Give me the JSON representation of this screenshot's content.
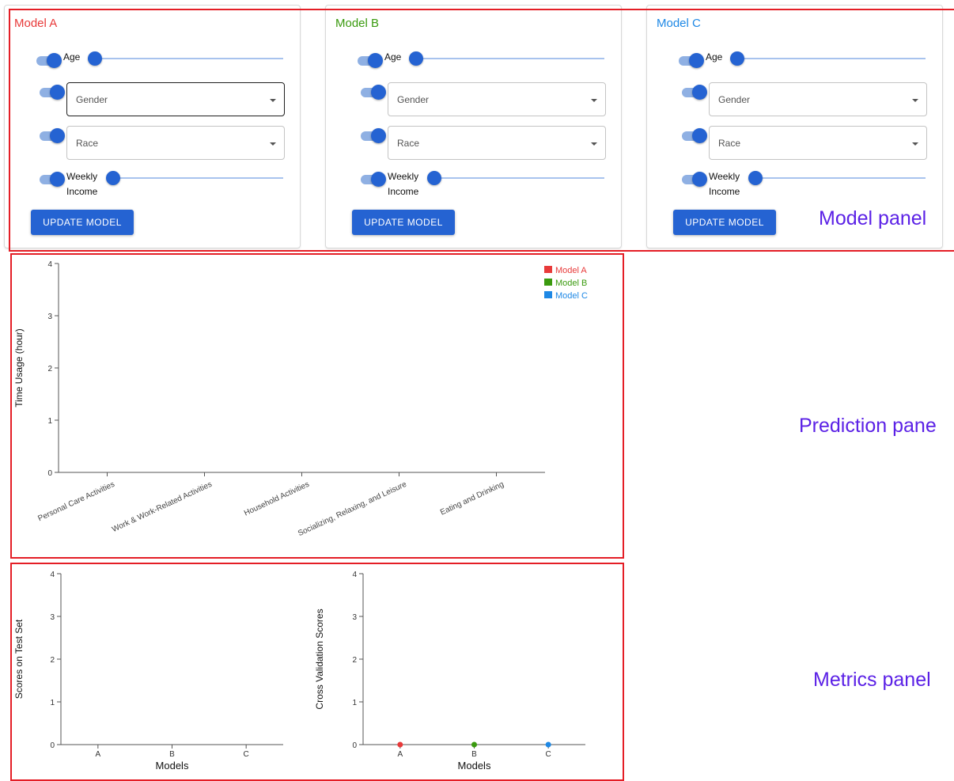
{
  "models": [
    {
      "title": "Model A",
      "title_color": "#e83a3a",
      "age_label": "Age",
      "gender_placeholder": "Gender",
      "race_placeholder": "Race",
      "income_label_line1": "Weekly",
      "income_label_line2": "Income",
      "update_label": "UPDATE MODEL"
    },
    {
      "title": "Model B",
      "title_color": "#3a9a0e",
      "age_label": "Age",
      "gender_placeholder": "Gender",
      "race_placeholder": "Race",
      "income_label_line1": "Weekly",
      "income_label_line2": "Income",
      "update_label": "UPDATE MODEL"
    },
    {
      "title": "Model C",
      "title_color": "#1e88e5",
      "age_label": "Age",
      "gender_placeholder": "Gender",
      "race_placeholder": "Race",
      "income_label_line1": "Weekly",
      "income_label_line2": "Income",
      "update_label": "UPDATE MODEL"
    }
  ],
  "annotations": {
    "model_panel": "Model panel",
    "prediction_panel": "Prediction pane",
    "metrics_panel": "Metrics panel"
  },
  "colors": {
    "accent": "#2563d2",
    "annotation_box": "#e41e26",
    "annotation_text": "#5b21e6"
  },
  "chart_data": [
    {
      "type": "bar",
      "title": "",
      "ylabel": "Time Usage (hour)",
      "xlabel": "",
      "categories": [
        "Personal Care Activities",
        "Work & Work-Related Activities",
        "Household Activities",
        "Socializing, Relaxing, and Leisure",
        "Eating and Drinking"
      ],
      "series": [
        {
          "name": "Model A",
          "color": "#e83a3a",
          "values": [
            0,
            0,
            0,
            0,
            0
          ]
        },
        {
          "name": "Model B",
          "color": "#3a9a0e",
          "values": [
            0,
            0,
            0,
            0,
            0
          ]
        },
        {
          "name": "Model C",
          "color": "#1e88e5",
          "values": [
            0,
            0,
            0,
            0,
            0
          ]
        }
      ],
      "ylim": [
        0,
        4
      ],
      "yticks": [
        "0",
        "1",
        "2",
        "3",
        "4"
      ],
      "legend": "top-right",
      "grid": false
    },
    {
      "type": "bar",
      "title": "",
      "ylabel": "Scores on Test Set",
      "xlabel": "Models",
      "categories": [
        "A",
        "B",
        "C"
      ],
      "values": [
        0,
        0,
        0
      ],
      "ylim": [
        0,
        4
      ],
      "yticks": [
        "0",
        "1",
        "2",
        "3",
        "4"
      ],
      "grid": false
    },
    {
      "type": "scatter",
      "title": "",
      "ylabel": "Cross Validation Scores",
      "xlabel": "Models",
      "categories": [
        "A",
        "B",
        "C"
      ],
      "values": [
        0,
        0,
        0
      ],
      "point_colors": [
        "#e83a3a",
        "#3a9a0e",
        "#1e88e5"
      ],
      "ylim": [
        0,
        4
      ],
      "yticks": [
        "0",
        "1",
        "2",
        "3",
        "4"
      ],
      "grid": false
    }
  ]
}
